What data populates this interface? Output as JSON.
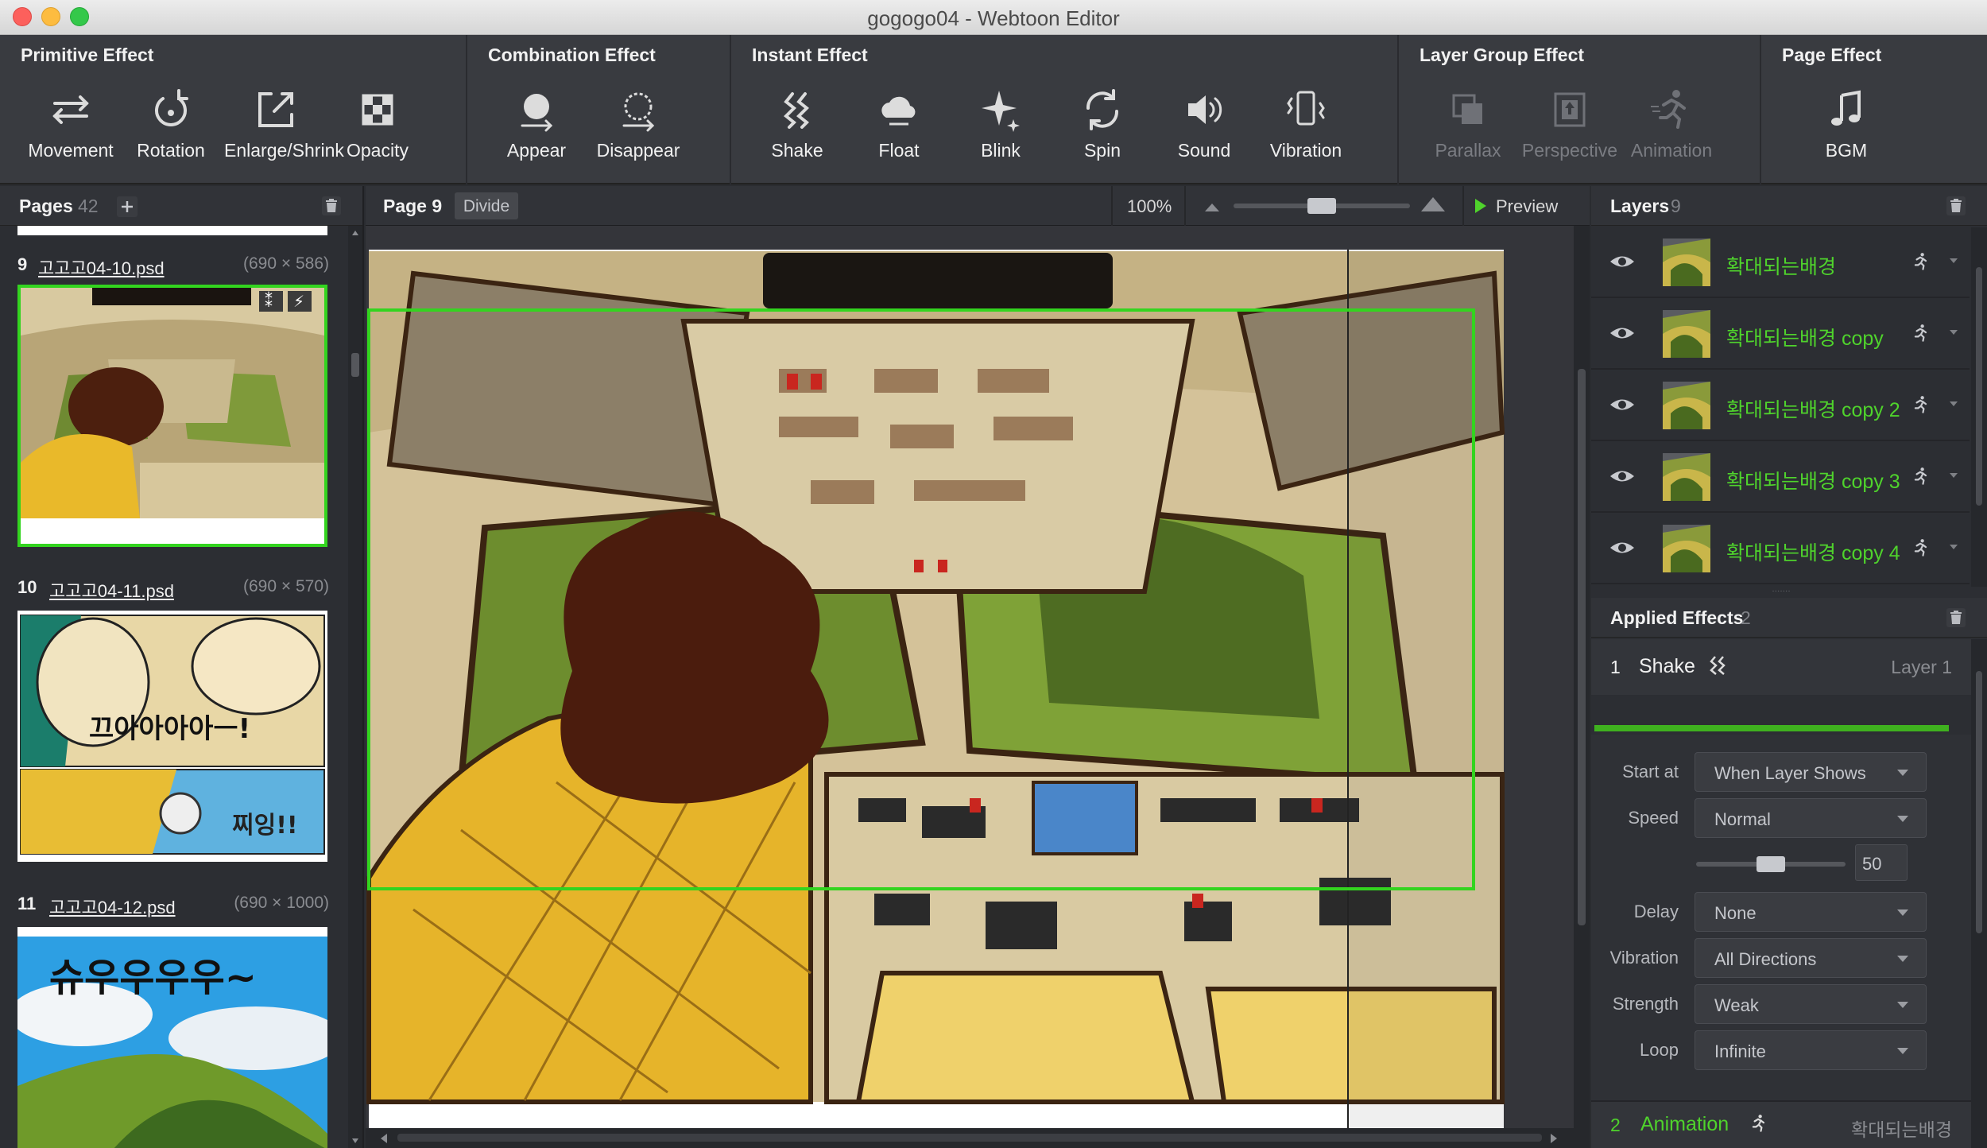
{
  "window": {
    "title": "gogogo04 - Webtoon Editor"
  },
  "toolbar": {
    "primitive": {
      "title": "Primitive Effect",
      "movement": "Movement",
      "rotation": "Rotation",
      "enlarge": "Enlarge/Shrink",
      "opacity": "Opacity"
    },
    "combination": {
      "title": "Combination Effect",
      "appear": "Appear",
      "disappear": "Disappear"
    },
    "instant": {
      "title": "Instant Effect",
      "shake": "Shake",
      "float": "Float",
      "blink": "Blink",
      "spin": "Spin",
      "sound": "Sound",
      "vibration": "Vibration"
    },
    "layer_group": {
      "title": "Layer Group Effect",
      "parallax": "Parallax",
      "perspective": "Perspective",
      "animation": "Animation"
    },
    "page": {
      "title": "Page Effect",
      "bgm": "BGM"
    }
  },
  "pages": {
    "title": "Pages",
    "count": "42",
    "items": [
      {
        "num": "9",
        "file": "고고고04-10.psd",
        "dims": "(690 × 586)"
      },
      {
        "num": "10",
        "file": "고고고04-11.psd",
        "dims": "(690 × 570)"
      },
      {
        "num": "11",
        "file": "고고고04-12.psd",
        "dims": "(690 × 1000)"
      }
    ],
    "thumb11_text": "슈우우우우~",
    "thumb10_text1": "끄아아아아ㅡ!",
    "thumb10_text2": "찌잉!!"
  },
  "editor": {
    "page_label": "Page 9",
    "divide_label": "Divide",
    "zoom": "100%",
    "zoom_level": 0.5,
    "preview_label": "Preview"
  },
  "layers": {
    "title": "Layers",
    "count": "9",
    "items": [
      {
        "name": "확대되는배경"
      },
      {
        "name": "확대되는배경 copy"
      },
      {
        "name": "확대되는배경 copy 2"
      },
      {
        "name": "확대되는배경 copy 3"
      },
      {
        "name": "확대되는배경 copy 4"
      }
    ]
  },
  "effects": {
    "title": "Applied Effects",
    "count": "2",
    "first": {
      "num": "1",
      "name": "Shake",
      "target": "Layer 1"
    },
    "props": {
      "start_at_label": "Start at",
      "start_at": "When Layer Shows",
      "speed_label": "Speed",
      "speed": "Normal",
      "speed_value": "50",
      "speed_level": 0.5,
      "delay_label": "Delay",
      "delay": "None",
      "vibration_label": "Vibration",
      "vibration": "All Directions",
      "strength_label": "Strength",
      "strength": "Weak",
      "loop_label": "Loop",
      "loop": "Infinite"
    },
    "second": {
      "num": "2",
      "name": "Animation",
      "target": "확대되는배경"
    }
  },
  "colors": {
    "accent_green": "#4fd32c",
    "selection_green": "#33d41f"
  }
}
